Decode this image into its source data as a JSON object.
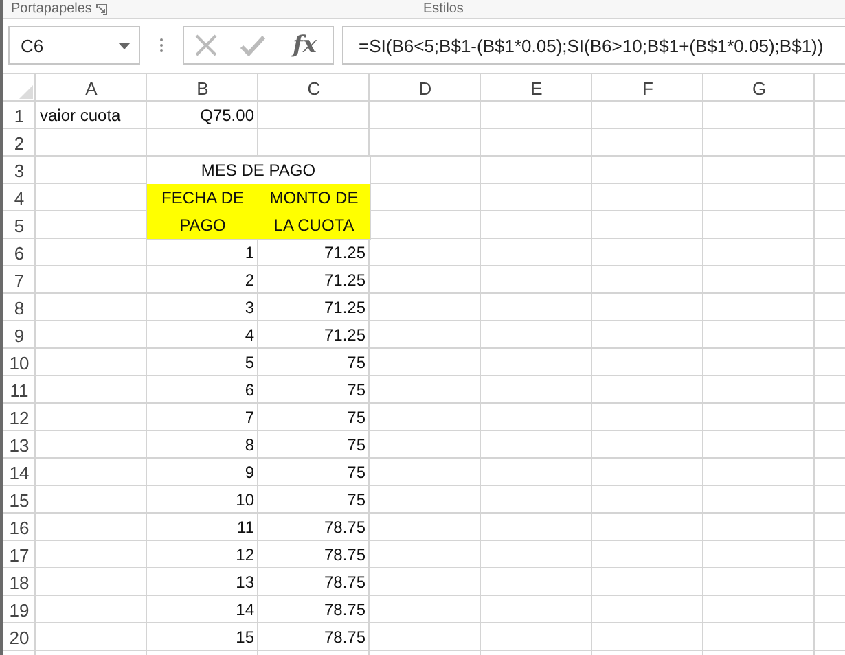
{
  "ribbon": {
    "groups": [
      {
        "label": "Portapapeles",
        "launcher": true
      },
      {
        "label": "Estilos"
      }
    ]
  },
  "name_box": {
    "value": "C6"
  },
  "function_button": {
    "label": "fx"
  },
  "formula_bar": {
    "value": "=SI(B6<5;B$1-(B$1*0.05);SI(B6>10;B$1+(B$1*0.05);B$1))"
  },
  "columns": [
    "A",
    "B",
    "C",
    "D",
    "E",
    "F",
    "G"
  ],
  "rows": [
    {
      "number": "1",
      "col_a": {
        "text": "vaior cuota",
        "kind": "label"
      },
      "col_b": {
        "text": "Q75.00",
        "kind": "number"
      }
    },
    {
      "number": "2"
    },
    {
      "number": "3",
      "col_b": {
        "text": "MES DE PAGO",
        "kind": "title",
        "span_right": true
      }
    },
    {
      "number": "4",
      "col_b": {
        "text": "FECHA DE PAGO",
        "kind": "header",
        "span_down": true
      },
      "col_c": {
        "text": "MONTO DE LA CUOTA",
        "kind": "header",
        "span_down": true
      }
    },
    {
      "number": "5"
    },
    {
      "number": "6",
      "col_b": {
        "text": "1",
        "kind": "number"
      },
      "col_c": {
        "text": "71.25",
        "kind": "number"
      }
    },
    {
      "number": "7",
      "col_b": {
        "text": "2",
        "kind": "number"
      },
      "col_c": {
        "text": "71.25",
        "kind": "number"
      }
    },
    {
      "number": "8",
      "col_b": {
        "text": "3",
        "kind": "number"
      },
      "col_c": {
        "text": "71.25",
        "kind": "number"
      }
    },
    {
      "number": "9",
      "col_b": {
        "text": "4",
        "kind": "number"
      },
      "col_c": {
        "text": "71.25",
        "kind": "number"
      }
    },
    {
      "number": "10",
      "col_b": {
        "text": "5",
        "kind": "number"
      },
      "col_c": {
        "text": "75",
        "kind": "number"
      }
    },
    {
      "number": "11",
      "col_b": {
        "text": "6",
        "kind": "number"
      },
      "col_c": {
        "text": "75",
        "kind": "number"
      }
    },
    {
      "number": "12",
      "col_b": {
        "text": "7",
        "kind": "number"
      },
      "col_c": {
        "text": "75",
        "kind": "number"
      }
    },
    {
      "number": "13",
      "col_b": {
        "text": "8",
        "kind": "number"
      },
      "col_c": {
        "text": "75",
        "kind": "number"
      }
    },
    {
      "number": "14",
      "col_b": {
        "text": "9",
        "kind": "number"
      },
      "col_c": {
        "text": "75",
        "kind": "number"
      }
    },
    {
      "number": "15",
      "col_b": {
        "text": "10",
        "kind": "number"
      },
      "col_c": {
        "text": "75",
        "kind": "number"
      }
    },
    {
      "number": "16",
      "col_b": {
        "text": "11",
        "kind": "number"
      },
      "col_c": {
        "text": "78.75",
        "kind": "number"
      }
    },
    {
      "number": "17",
      "col_b": {
        "text": "12",
        "kind": "number"
      },
      "col_c": {
        "text": "78.75",
        "kind": "number"
      }
    },
    {
      "number": "18",
      "col_b": {
        "text": "13",
        "kind": "number"
      },
      "col_c": {
        "text": "78.75",
        "kind": "number"
      }
    },
    {
      "number": "19",
      "col_b": {
        "text": "14",
        "kind": "number"
      },
      "col_c": {
        "text": "78.75",
        "kind": "number"
      }
    },
    {
      "number": "20",
      "col_b": {
        "text": "15",
        "kind": "number"
      },
      "col_c": {
        "text": "78.75",
        "kind": "number"
      }
    }
  ]
}
